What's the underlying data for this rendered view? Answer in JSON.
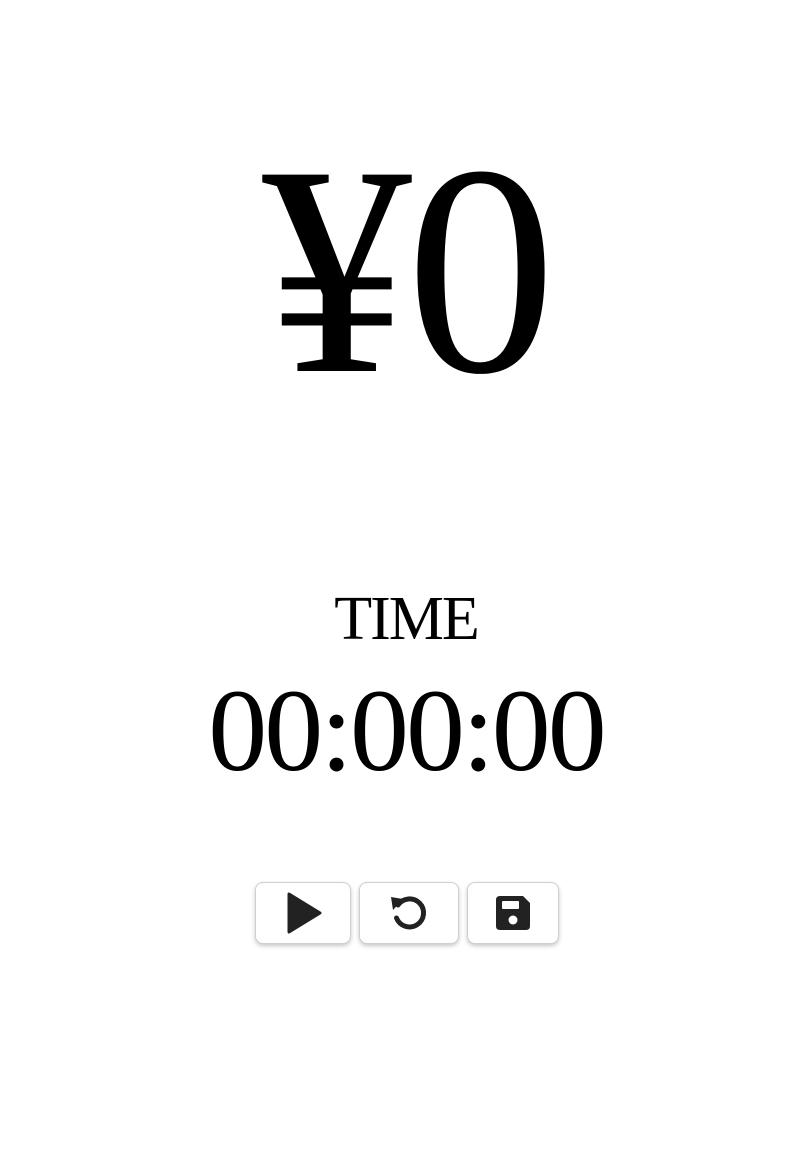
{
  "display": {
    "amount": "¥0",
    "time_label": "TIME",
    "time_value": "00:00:00"
  },
  "controls": [
    {
      "icon": "play-icon",
      "action": "start"
    },
    {
      "icon": "reset-icon",
      "action": "reset"
    },
    {
      "icon": "save-icon",
      "action": "save"
    }
  ],
  "colors": {
    "text": "#000000",
    "icon": "#222222",
    "button_border": "#cfcfcf",
    "background": "#ffffff"
  }
}
